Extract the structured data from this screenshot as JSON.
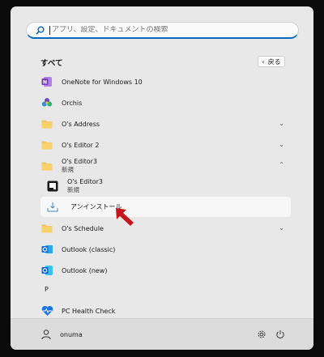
{
  "search": {
    "placeholder": "アプリ、設定、ドキュメントの検索"
  },
  "section": {
    "title": "すべて",
    "back_label": "戻る"
  },
  "apps": [
    {
      "name": "OneNote for Windows 10",
      "icon": "onenote-icon"
    },
    {
      "name": "Orchis",
      "icon": "orchis-icon"
    },
    {
      "name": "O's Address",
      "icon": "folder-icon",
      "expand": "chevron-down"
    },
    {
      "name": "O's Editor 2",
      "icon": "folder-icon",
      "expand": "chevron-down"
    },
    {
      "name": "O's Editor3",
      "sub": "新規",
      "icon": "folder-icon",
      "expand": "chevron-up"
    },
    {
      "name": "O's Editor3",
      "sub": "新規",
      "icon": "oseditor-app-icon"
    },
    {
      "name": "アンインストール",
      "icon": "uninstall-icon"
    },
    {
      "name": "O's Schedule",
      "icon": "folder-icon",
      "expand": "chevron-down"
    },
    {
      "name": "Outlook (classic)",
      "icon": "outlook-icon"
    },
    {
      "name": "Outlook (new)",
      "icon": "outlook-new-icon"
    },
    {
      "name": "PC Health Check",
      "icon": "health-check-icon"
    }
  ],
  "letter_header": "P",
  "user": {
    "name": "onuma"
  },
  "colors": {
    "accent": "#0067c0",
    "folder": "#f5c35a",
    "arrow": "#c4161c",
    "onenote": "#7b3fbe",
    "outlook": "#1167d8"
  }
}
